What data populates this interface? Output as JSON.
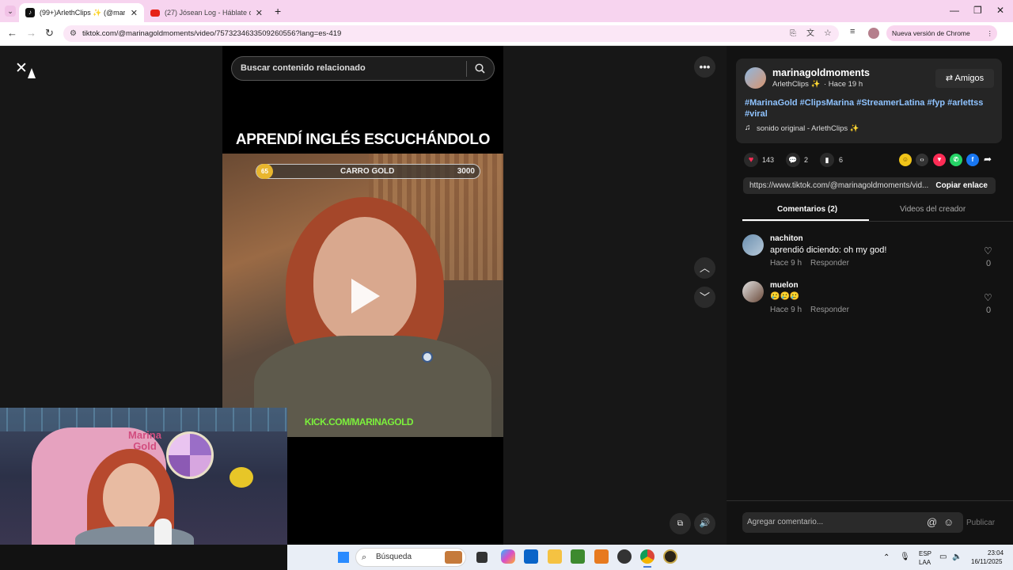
{
  "browser": {
    "tabs": [
      {
        "title": "(99+)ArlethClips ✨ (@marinag",
        "active": true
      },
      {
        "title": "(27) Jósean Log - Háblate de M",
        "active": false
      }
    ],
    "url": "tiktok.com/@marinagoldmoments/video/7573234633509260556?lang=es-419",
    "update_label": "Nueva versión de Chrome disponible"
  },
  "player": {
    "search_placeholder": "Buscar contenido relacionado",
    "headline": "APRENDÍ INGLÉS ESCUCHÁNDOLO",
    "overlay": {
      "coin_value": "65",
      "label": "CARRO GOLD",
      "target": "3000"
    },
    "watermark": "KICK.COM/MARINAGOLD",
    "webcam_sign": "Marina Gold"
  },
  "post": {
    "username": "marinagoldmoments",
    "display_name": "ArlethClips ✨",
    "time_ago": "· Hace 19 h",
    "friends_label": "Amigos",
    "hashtags": "#MarinaGold #ClipsMarina #StreamerLatina #fyp #arlettss #viral",
    "sound": "sonido original - ArlethClips ✨",
    "likes": "143",
    "comments": "2",
    "saves": "6",
    "link": "https://www.tiktok.com/@marinagoldmoments/vid...",
    "copy_label": "Copiar enlace"
  },
  "tabs": {
    "comments": "Comentarios (2)",
    "creator": "Videos del creador"
  },
  "comments": [
    {
      "user": "nachiton",
      "text": "aprendió diciendo: oh my god!",
      "time": "Hace 9 h",
      "reply": "Responder",
      "likes": "0"
    },
    {
      "user": "muelon",
      "text": "🥲🥲🥲",
      "time": "Hace 9 h",
      "reply": "Responder",
      "likes": "0"
    }
  ],
  "composer": {
    "placeholder": "Agregar comentario...",
    "publish": "Publicar"
  },
  "taskbar": {
    "search": "Búsqueda",
    "lang_top": "ESP",
    "lang_bottom": "LAA",
    "time": "23:04",
    "date": "16/11/2025"
  },
  "colors": {
    "accent": "#fe2c55",
    "hashtag": "#8fc3ff",
    "tab_strip": "#f7d4ef"
  }
}
